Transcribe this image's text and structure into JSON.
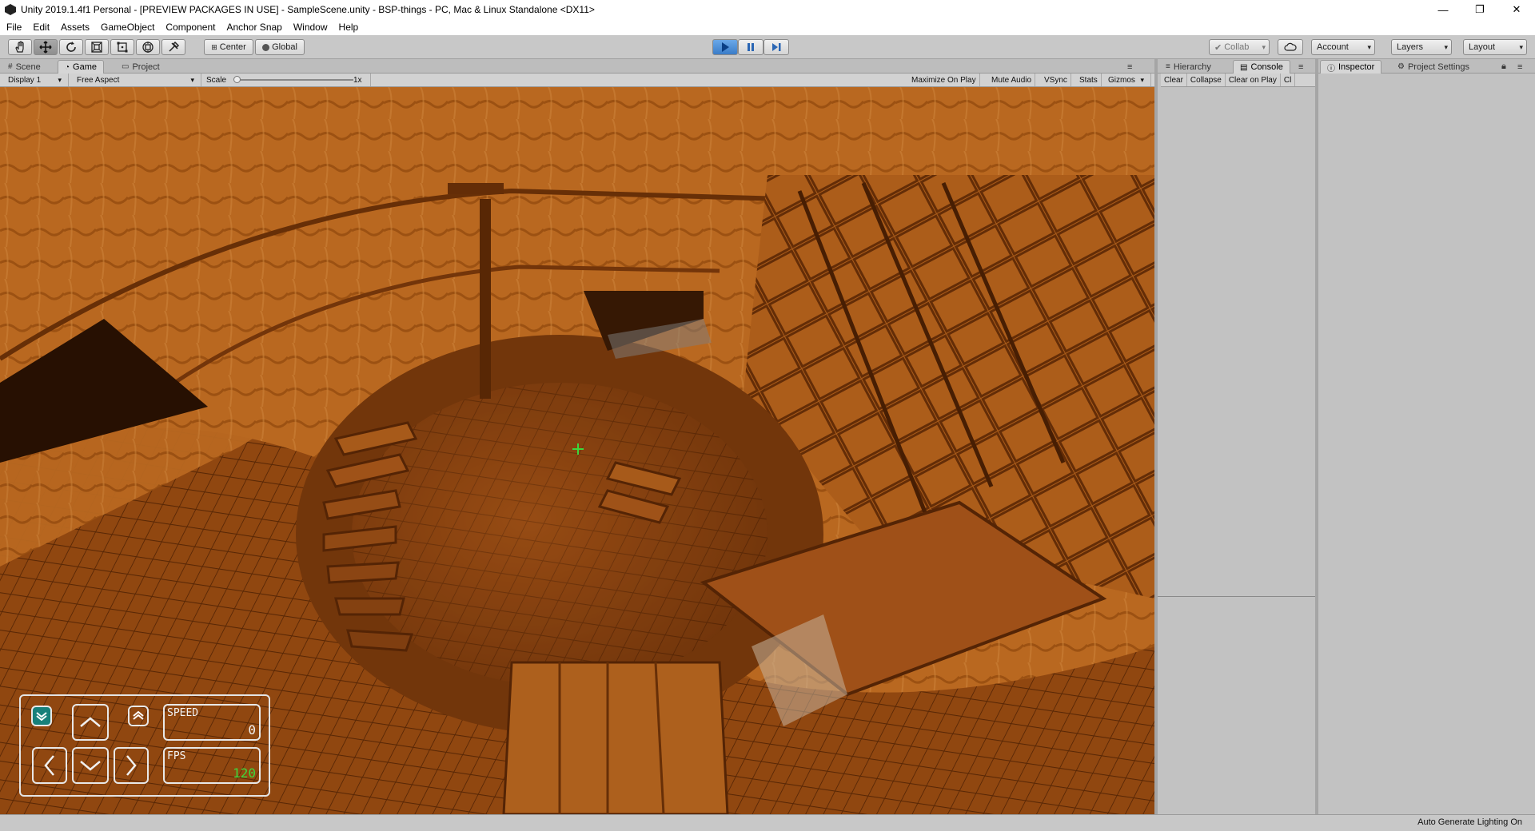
{
  "window": {
    "title": "Unity 2019.1.4f1 Personal - [PREVIEW PACKAGES IN USE] - SampleScene.unity - BSP-things - PC, Mac & Linux Standalone <DX11>",
    "controls": {
      "minimize": "—",
      "restore": "❐",
      "close": "✕"
    }
  },
  "menu": [
    "File",
    "Edit",
    "Assets",
    "GameObject",
    "Component",
    "Anchor Snap",
    "Window",
    "Help"
  ],
  "toolbar": {
    "tools": [
      "hand-icon",
      "move-icon",
      "rotate-icon",
      "scale-icon",
      "rect-icon",
      "transform-icon",
      "custom-tool-icon"
    ],
    "pivot": "Center",
    "space": "Global",
    "collab": "Collab",
    "account": "Account",
    "layers": "Layers",
    "layout": "Layout",
    "play_state": "playing",
    "accent": "#3a7cc8"
  },
  "tabs": {
    "left": [
      {
        "label": "Scene",
        "icon": "grid-icon"
      },
      {
        "label": "Game",
        "icon": "pacman-icon"
      },
      {
        "label": "Project",
        "icon": "folder-icon"
      }
    ],
    "middle": [
      {
        "label": "Hierarchy",
        "icon": "list-icon"
      },
      {
        "label": "Console",
        "icon": "console-icon"
      }
    ],
    "right": [
      {
        "label": "Inspector",
        "icon": "info-icon"
      },
      {
        "label": "Project Settings",
        "icon": "gear-icon"
      }
    ]
  },
  "gamebar": {
    "display": "Display 1",
    "aspect": "Free Aspect",
    "scale_label": "Scale",
    "scale_value": "1x",
    "maximize": "Maximize On Play",
    "mute": "Mute Audio",
    "vsync": "VSync",
    "stats": "Stats",
    "gizmos": "Gizmos"
  },
  "console": {
    "clear": "Clear",
    "collapse": "Collapse",
    "clear_on_play": "Clear on Play",
    "more": "Cl"
  },
  "hud": {
    "speed_label": "SPEED",
    "speed_value": "0",
    "fps_label": "FPS",
    "fps_value": "120",
    "fps_color": "#3cd83c",
    "speed_color": "#f2f2f2",
    "buttons": [
      "descend-icon",
      "ascend-icon",
      "forward-icon",
      "left-icon",
      "back-icon",
      "right-icon"
    ]
  },
  "status": {
    "text": "Auto Generate Lighting On"
  }
}
